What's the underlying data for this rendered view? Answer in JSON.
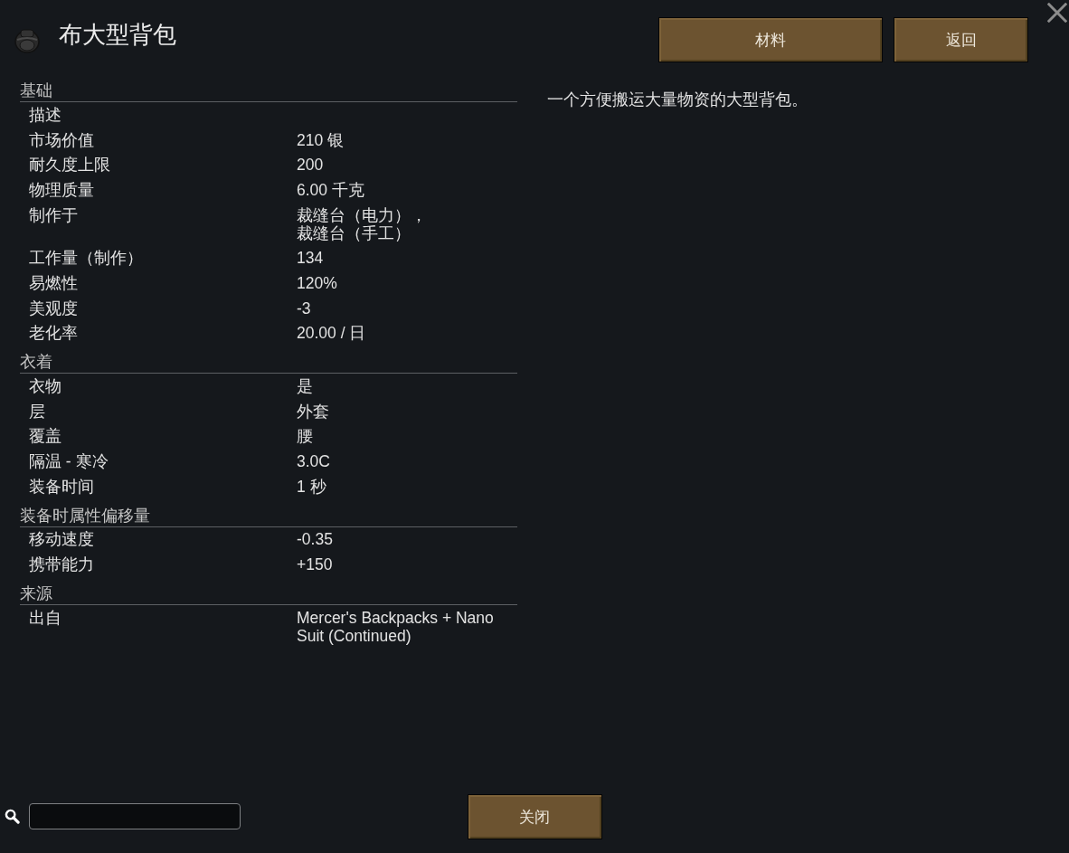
{
  "title": "布大型背包",
  "header_buttons": [
    {
      "label": "材料"
    },
    {
      "label": "返回"
    }
  ],
  "sections": [
    {
      "title": "基础",
      "rows": [
        {
          "label": "描述"
        },
        {
          "label": "市场价值",
          "value": "210 银"
        },
        {
          "label": "耐久度上限",
          "value": "200"
        },
        {
          "label": "物理质量",
          "value": "6.00 千克"
        },
        {
          "label": "制作于",
          "value_lines": [
            "裁缝台（电力），",
            "裁缝台（手工）"
          ]
        },
        {
          "label": "工作量（制作）",
          "value": "134"
        },
        {
          "label": "易燃性",
          "value": "120%"
        },
        {
          "label": "美观度",
          "value": "-3"
        },
        {
          "label": "老化率",
          "value": "20.00 / 日"
        }
      ]
    },
    {
      "title": "衣着",
      "rows": [
        {
          "label": "衣物",
          "value": "是"
        },
        {
          "label": "层",
          "value": "外套"
        },
        {
          "label": "覆盖",
          "value": "腰"
        },
        {
          "label": "隔温 - 寒冷",
          "value": "3.0C"
        },
        {
          "label": "装备时间",
          "value": "1 秒"
        }
      ]
    },
    {
      "title": "装备时属性偏移量",
      "rows": [
        {
          "label": "移动速度",
          "value": "-0.35"
        },
        {
          "label": "携带能力",
          "value": "+150"
        }
      ]
    },
    {
      "title": "来源",
      "rows": [
        {
          "label": "出自",
          "value": "Mercer's Backpacks + Nano Suit (Continued)"
        }
      ]
    }
  ],
  "description": "一个方便搬运大量物资的大型背包。",
  "footer_button": "关闭"
}
